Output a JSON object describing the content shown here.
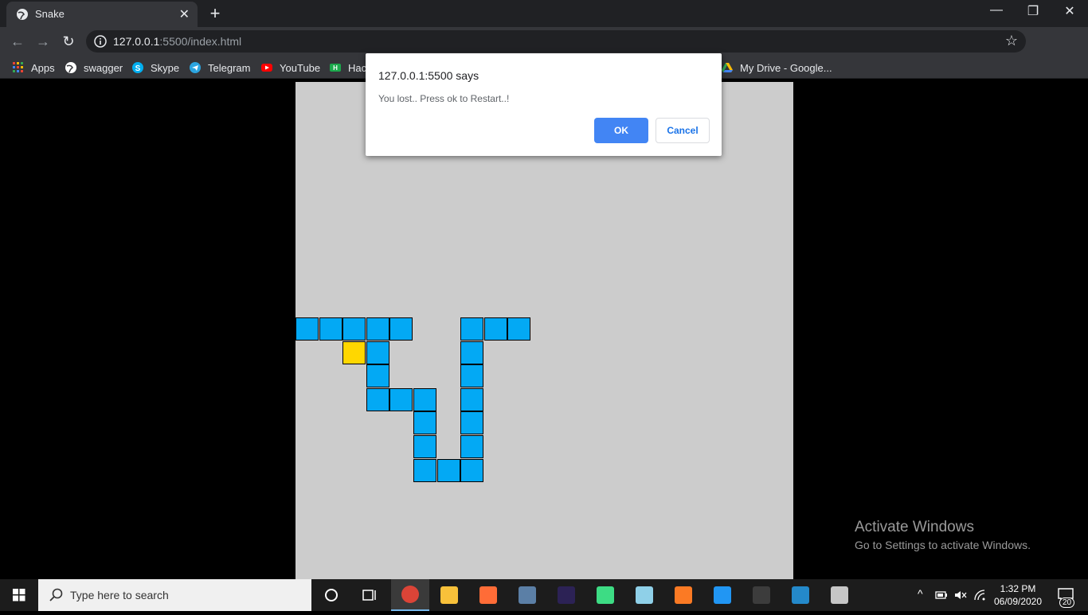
{
  "browser": {
    "tab_title": "Snake",
    "url_host": "127.0.0.1",
    "url_rest": ":5500/index.html",
    "bookmarks": [
      {
        "label": "Apps",
        "icon": "apps-grid-icon",
        "color": "#ea4335"
      },
      {
        "label": "swagger",
        "icon": "globe-icon",
        "color": "#ffffff"
      },
      {
        "label": "Skype",
        "icon": "skype-icon",
        "color": "#00aff0"
      },
      {
        "label": "Telegram",
        "icon": "telegram-icon",
        "color": "#2ca5e0"
      },
      {
        "label": "YouTube",
        "icon": "youtube-icon",
        "color": "#ff0000"
      },
      {
        "label": "Hac",
        "icon": "hackerrank-icon",
        "color": "#2ec866"
      },
      {
        "label": "My Drive - Google...",
        "icon": "google-drive-icon",
        "color": "#fbbc04"
      }
    ]
  },
  "dialog": {
    "origin": "127.0.0.1:5500 says",
    "message": "You lost.. Press ok to Restart..!",
    "ok_label": "OK",
    "cancel_label": "Cancel"
  },
  "game": {
    "grid_size": 21,
    "snake_color": "#03a9f4",
    "food_color": "#ffd700",
    "board_color": "#cccccc",
    "snake": [
      [
        0,
        10
      ],
      [
        1,
        10
      ],
      [
        2,
        10
      ],
      [
        3,
        10
      ],
      [
        4,
        10
      ],
      [
        3,
        11
      ],
      [
        3,
        12
      ],
      [
        3,
        13
      ],
      [
        4,
        13
      ],
      [
        5,
        13
      ],
      [
        5,
        14
      ],
      [
        5,
        15
      ],
      [
        5,
        16
      ],
      [
        6,
        16
      ],
      [
        7,
        16
      ],
      [
        7,
        15
      ],
      [
        7,
        14
      ],
      [
        7,
        13
      ],
      [
        7,
        12
      ],
      [
        7,
        11
      ],
      [
        7,
        10
      ],
      [
        8,
        10
      ],
      [
        9,
        10
      ]
    ],
    "food": [
      2,
      11
    ]
  },
  "watermark": {
    "line1": "Activate Windows",
    "line2": "Go to Settings to activate Windows."
  },
  "taskbar": {
    "search_placeholder": "Type here to search",
    "time": "1:32 PM",
    "date": "06/09/2020",
    "notification_count": "20",
    "apps": [
      {
        "name": "chrome",
        "color": "#db4437"
      },
      {
        "name": "file-explorer",
        "color": "#f8c13a"
      },
      {
        "name": "postman",
        "color": "#ff6c37"
      },
      {
        "name": "mysql-workbench",
        "color": "#5b7fa6"
      },
      {
        "name": "eclipse",
        "color": "#2c2255"
      },
      {
        "name": "android-studio",
        "color": "#3ddc84"
      },
      {
        "name": "notepad",
        "color": "#8fd0e8"
      },
      {
        "name": "xampp",
        "color": "#fb7a24"
      },
      {
        "name": "wps-writer",
        "color": "#2196f3"
      },
      {
        "name": "terminal",
        "color": "#3c3c3c"
      },
      {
        "name": "vscode",
        "color": "#2489ca"
      },
      {
        "name": "paint",
        "color": "#c6c6c6"
      }
    ]
  }
}
